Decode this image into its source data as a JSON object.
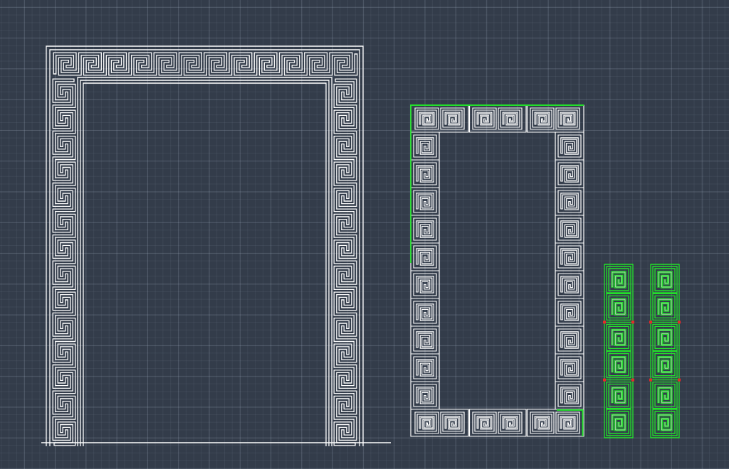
{
  "canvas": {
    "grid": true
  },
  "drawings": [
    {
      "kind": "meander",
      "color": "#ffffff"
    },
    {
      "kind": "frame",
      "color": "#ffffff"
    },
    {
      "kind": "edge",
      "color": "#22e02a"
    },
    {
      "kind": "edge",
      "color": "#22e02a"
    },
    {
      "kind": "strip",
      "color": "#22e02a"
    },
    {
      "kind": "strip",
      "color": "#22e02a"
    }
  ]
}
